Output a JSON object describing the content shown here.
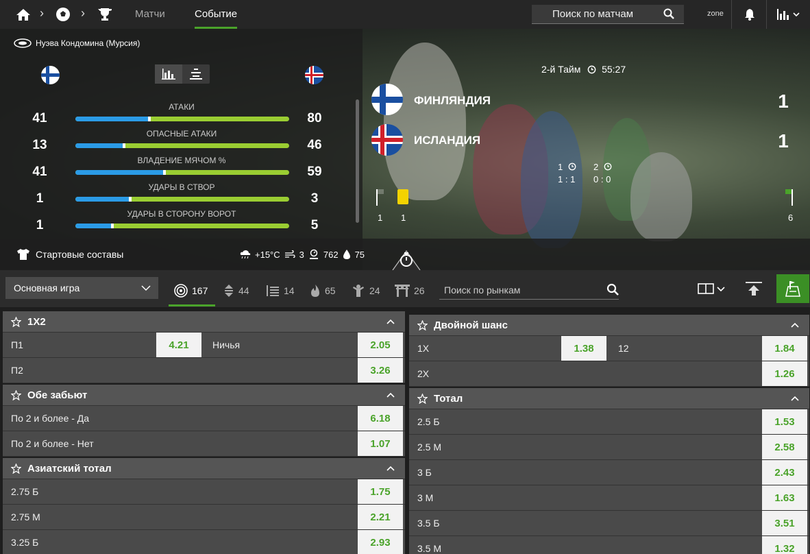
{
  "topbar": {
    "tabs": [
      {
        "label": "Матчи"
      },
      {
        "label": "Событие"
      }
    ],
    "search_label": "Поиск по матчам",
    "zone_label": "zone"
  },
  "match": {
    "venue": "Нуэва Кондомина (Мурсия)",
    "period": "2-й Тайм",
    "clock": "55:27",
    "team1": {
      "name": "ФИНЛЯНДИЯ",
      "score": "1"
    },
    "team2": {
      "name": "ИСЛАНДИЯ",
      "score": "1"
    },
    "halves": [
      {
        "label": "1",
        "score": "1 : 1"
      },
      {
        "label": "2",
        "score": "0 : 0"
      }
    ],
    "counters": {
      "team1_corners": "1",
      "yellow_cards": "1",
      "team2_corners": "6"
    },
    "lineups_label": "Стартовые составы",
    "weather": {
      "temp": "+15°C",
      "wind": "3",
      "pressure": "762",
      "humidity": "75"
    }
  },
  "stats": [
    {
      "label": "АТАКИ",
      "left": "41",
      "right": "80",
      "share": 0.339
    },
    {
      "label": "ОПАСНЫЕ АТАКИ",
      "left": "13",
      "right": "46",
      "share": 0.22
    },
    {
      "label": "ВЛАДЕНИЕ МЯЧОМ %",
      "left": "41",
      "right": "59",
      "share": 0.41
    },
    {
      "label": "УДАРЫ В СТВОР",
      "left": "1",
      "right": "3",
      "share": 0.25
    },
    {
      "label": "УДАРЫ В СТОРОНУ ВОРОТ",
      "left": "1",
      "right": "5",
      "share": 0.167
    }
  ],
  "filters": {
    "select": "Основная игра",
    "chips": [
      {
        "icon": "target-icon",
        "count": "167"
      },
      {
        "icon": "updown-arrows-icon",
        "count": "44"
      },
      {
        "icon": "bars-stack-icon",
        "count": "14"
      },
      {
        "icon": "fire-icon",
        "count": "65"
      },
      {
        "icon": "player-icon",
        "count": "24"
      },
      {
        "icon": "gate-icon",
        "count": "26"
      }
    ],
    "market_search": "Поиск по рынкам"
  },
  "markets_left": [
    {
      "title": "1X2",
      "rows": [
        [
          {
            "label": "П1",
            "odd": "4.21"
          },
          {
            "label": "Ничья",
            "odd": "2.05"
          }
        ],
        [
          {
            "label": "П2",
            "odd": "3.26"
          }
        ]
      ]
    },
    {
      "title": "Обе забьют",
      "rows": [
        [
          {
            "label": "По 2 и более - Да",
            "odd": "6.18"
          }
        ],
        [
          {
            "label": "По 2 и более - Нет",
            "odd": "1.07"
          }
        ]
      ]
    },
    {
      "title": "Азиатский тотал",
      "rows": [
        [
          {
            "label": "2.75 Б",
            "odd": "1.75"
          }
        ],
        [
          {
            "label": "2.75 М",
            "odd": "2.21"
          }
        ],
        [
          {
            "label": "3.25 Б",
            "odd": "2.93"
          }
        ]
      ]
    }
  ],
  "markets_right": [
    {
      "title": "Двойной шанс",
      "rows": [
        [
          {
            "label": "1X",
            "odd": "1.38"
          },
          {
            "label": "12",
            "odd": "1.84"
          }
        ],
        [
          {
            "label": "2X",
            "odd": "1.26"
          }
        ]
      ]
    },
    {
      "title": "Тотал",
      "rows": [
        [
          {
            "label": "2.5 Б",
            "odd": "1.53"
          }
        ],
        [
          {
            "label": "2.5 М",
            "odd": "2.58"
          }
        ],
        [
          {
            "label": "3 Б",
            "odd": "2.43"
          }
        ],
        [
          {
            "label": "3 М",
            "odd": "1.63"
          }
        ],
        [
          {
            "label": "3.5 Б",
            "odd": "3.51"
          }
        ],
        [
          {
            "label": "3.5 М",
            "odd": "1.32"
          }
        ]
      ]
    }
  ],
  "colors": {
    "accent": "#4aa32a",
    "home_bar": "#2b9be6",
    "away_bar": "#9acd32"
  }
}
